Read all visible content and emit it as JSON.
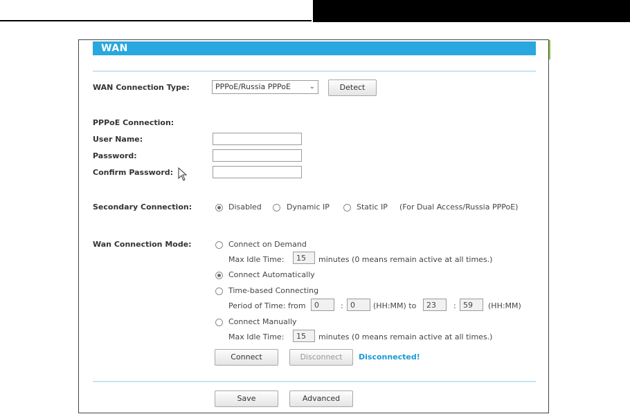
{
  "page": {
    "title": "WAN",
    "help_icon": "help-icon"
  },
  "wan_type": {
    "label": "WAN Connection Type:",
    "selected": "PPPoE/Russia PPPoE",
    "detect_label": "Detect"
  },
  "pppoe": {
    "heading": "PPPoE Connection:",
    "username_label": "User Name:",
    "password_label": "Password:",
    "confirm_label": "Confirm Password:",
    "username_value": "",
    "password_value": "",
    "confirm_value": ""
  },
  "secondary": {
    "label": "Secondary Connection:",
    "options": [
      "Disabled",
      "Dynamic IP",
      "Static IP"
    ],
    "selected": "Disabled",
    "note": "(For Dual Access/Russia PPPoE)"
  },
  "mode": {
    "label": "Wan Connection Mode:",
    "connect_on_demand": "Connect on Demand",
    "max_idle_label": "Max Idle Time:",
    "max_idle_value_1": "15",
    "minutes_note": "minutes (0 means remain active at all times.)",
    "connect_automatically": "Connect Automatically",
    "time_based": "Time-based Connecting",
    "period_label": "Period of Time: from",
    "from_hh": "0",
    "from_mm": "0",
    "sep": ":",
    "hhmm_to": "(HH:MM) to",
    "to_hh": "23",
    "to_mm": "59",
    "hhmm": "(HH:MM)",
    "connect_manually": "Connect Manually",
    "max_idle_value_2": "15",
    "selected": "Connect Automatically"
  },
  "actions": {
    "connect_label": "Connect",
    "disconnect_label": "Disconnect",
    "status": "Disconnected!",
    "save_label": "Save",
    "advanced_label": "Advanced"
  },
  "colors": {
    "title_bar": "#2aa7df",
    "status": "#1a9ad6",
    "help": "#8cc63f"
  }
}
